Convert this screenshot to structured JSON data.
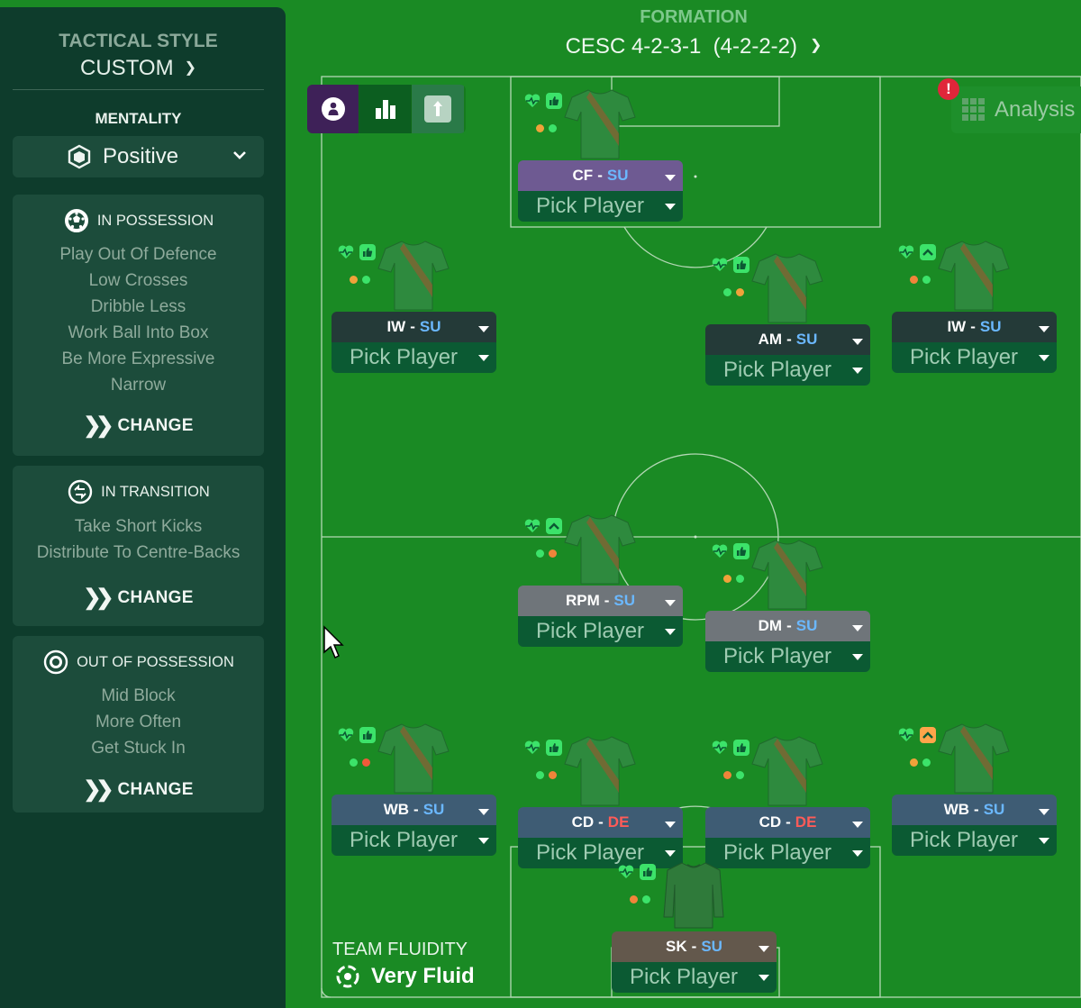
{
  "sidebar": {
    "tactical_style_label": "TACTICAL STYLE",
    "tactical_style_value": "CUSTOM",
    "mentality_label": "MENTALITY",
    "mentality_value": "Positive",
    "in_possession": {
      "title": "IN POSSESSION",
      "items": [
        "Play Out Of Defence",
        "Low Crosses",
        "Dribble Less",
        "Work Ball Into Box",
        "Be More Expressive",
        "Narrow"
      ],
      "change_label": "CHANGE"
    },
    "in_transition": {
      "title": "IN TRANSITION",
      "items": [
        "Take Short Kicks",
        "Distribute To Centre-Backs"
      ],
      "change_label": "CHANGE"
    },
    "out_of_possession": {
      "title": "OUT OF POSSESSION",
      "items": [
        "Mid Block",
        "More Often",
        "Get Stuck In"
      ],
      "change_label": "CHANGE"
    }
  },
  "header": {
    "formation_label": "FORMATION",
    "formation_value": "CESC 4-2-3-1  (4-2-2-2)"
  },
  "toolbar": {
    "analysis_label": "Analysis",
    "alert_symbol": "!"
  },
  "slots": [
    {
      "role": "CF",
      "duty": "SU",
      "pick": "Pick Player",
      "role_style": "purple",
      "dots": [
        "#f0a23a",
        "#3ce36a"
      ],
      "mood": "thumb"
    },
    {
      "role": "IW",
      "duty": "SU",
      "pick": "Pick Player",
      "role_style": "dark",
      "dots": [
        "#f0a23a",
        "#3ce36a"
      ],
      "mood": "thumb"
    },
    {
      "role": "AM",
      "duty": "SU",
      "pick": "Pick Player",
      "role_style": "dark",
      "dots": [
        "#3ce36a",
        "#f0a23a"
      ],
      "mood": "thumb"
    },
    {
      "role": "IW",
      "duty": "SU",
      "pick": "Pick Player",
      "role_style": "dark",
      "dots": [
        "#f0843a",
        "#3ce36a"
      ],
      "mood": "up"
    },
    {
      "role": "RPM",
      "duty": "SU",
      "pick": "Pick Player",
      "role_style": "grey",
      "dots": [
        "#3ce36a",
        "#f0843a"
      ],
      "mood": "up"
    },
    {
      "role": "DM",
      "duty": "SU",
      "pick": "Pick Player",
      "role_style": "grey",
      "dots": [
        "#f0a23a",
        "#3ce36a"
      ],
      "mood": "thumb"
    },
    {
      "role": "WB",
      "duty": "SU",
      "pick": "Pick Player",
      "role_style": "blue",
      "dots": [
        "#3ce36a",
        "#f05a3a"
      ],
      "mood": "thumb"
    },
    {
      "role": "CD",
      "duty": "DE",
      "pick": "Pick Player",
      "role_style": "blue",
      "dots": [
        "#3ce36a",
        "#f0843a"
      ],
      "mood": "thumb"
    },
    {
      "role": "CD",
      "duty": "DE",
      "pick": "Pick Player",
      "role_style": "blue",
      "dots": [
        "#f0843a",
        "#3ce36a"
      ],
      "mood": "thumb"
    },
    {
      "role": "WB",
      "duty": "SU",
      "pick": "Pick Player",
      "role_style": "blue",
      "dots": [
        "#f0a23a",
        "#3ce36a"
      ],
      "mood": "up-orange"
    },
    {
      "role": "SK",
      "duty": "SU",
      "pick": "Pick Player",
      "role_style": "brown",
      "dots": [
        "#f0843a",
        "#3ce36a"
      ],
      "mood": "thumb",
      "goalkeeper": true
    }
  ],
  "fluidity": {
    "label": "TEAM FLUIDITY",
    "value": "Very Fluid"
  },
  "colors": {
    "pitch": "#1a8a24",
    "panel": "#0e3c2c",
    "card": "#1c4c3b",
    "shirt": "#2e8a3e",
    "shirt_sash": "#a8522c",
    "keeper_shirt": "#2f7a3a",
    "icon_green": "#3ce36a",
    "duty_support": "#6bb8ff",
    "duty_defend": "#ff5b58"
  }
}
